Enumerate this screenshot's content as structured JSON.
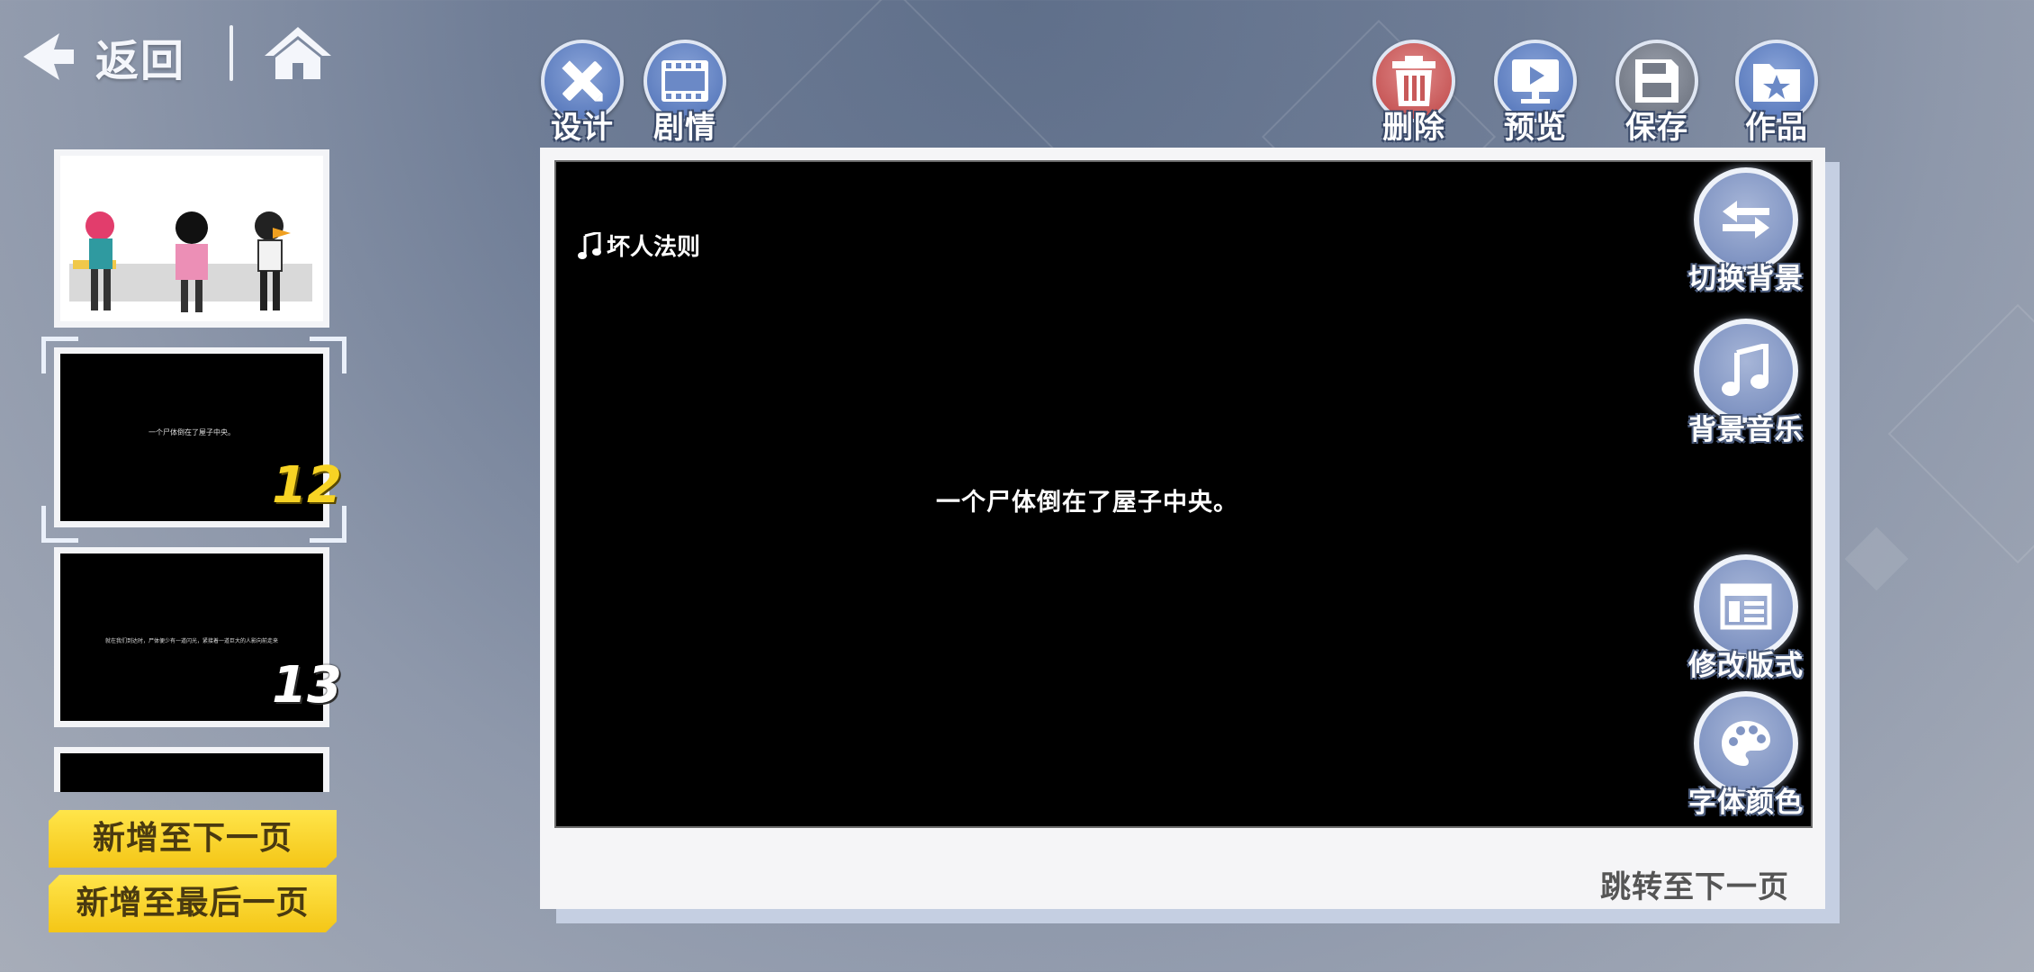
{
  "nav": {
    "back_label": "返回"
  },
  "toolbar_left": [
    {
      "label": "设计",
      "icon": "pencil-ruler-icon"
    },
    {
      "label": "剧情",
      "icon": "film-strip-icon"
    }
  ],
  "toolbar_right": [
    {
      "label": "删除",
      "icon": "trash-icon"
    },
    {
      "label": "预览",
      "icon": "preview-play-icon"
    },
    {
      "label": "保存",
      "icon": "save-disk-icon"
    },
    {
      "label": "作品",
      "icon": "folder-star-icon"
    }
  ],
  "thumbnails": [
    {
      "number": "",
      "caption": "",
      "kind": "characters"
    },
    {
      "number": "12",
      "caption": "一个尸体倒在了屋子中央。",
      "selected": true
    },
    {
      "number": "13",
      "caption": "就在我们到达时，尸体便少有一道闪光，紧接着一道巨大的人影向前走来"
    },
    {
      "number": "",
      "caption": ""
    }
  ],
  "actions": {
    "add_next": "新增至下一页",
    "add_last": "新增至最后一页"
  },
  "stage": {
    "music_title": "坏人法则",
    "narration": "一个尸体倒在了屋子中央。"
  },
  "side_buttons": [
    {
      "label": "切换背景",
      "icon": "swap-arrows-icon"
    },
    {
      "label": "背景音乐",
      "icon": "music-note-icon"
    },
    {
      "label": "修改版式",
      "icon": "layout-icon"
    },
    {
      "label": "字体颜色",
      "icon": "palette-icon"
    }
  ],
  "next_page_link": "跳转至下一页",
  "colors": {
    "accent_yellow": "#f7d324",
    "toolbar_blue": "#5f7fc0",
    "delete_red": "#c85a5a"
  }
}
